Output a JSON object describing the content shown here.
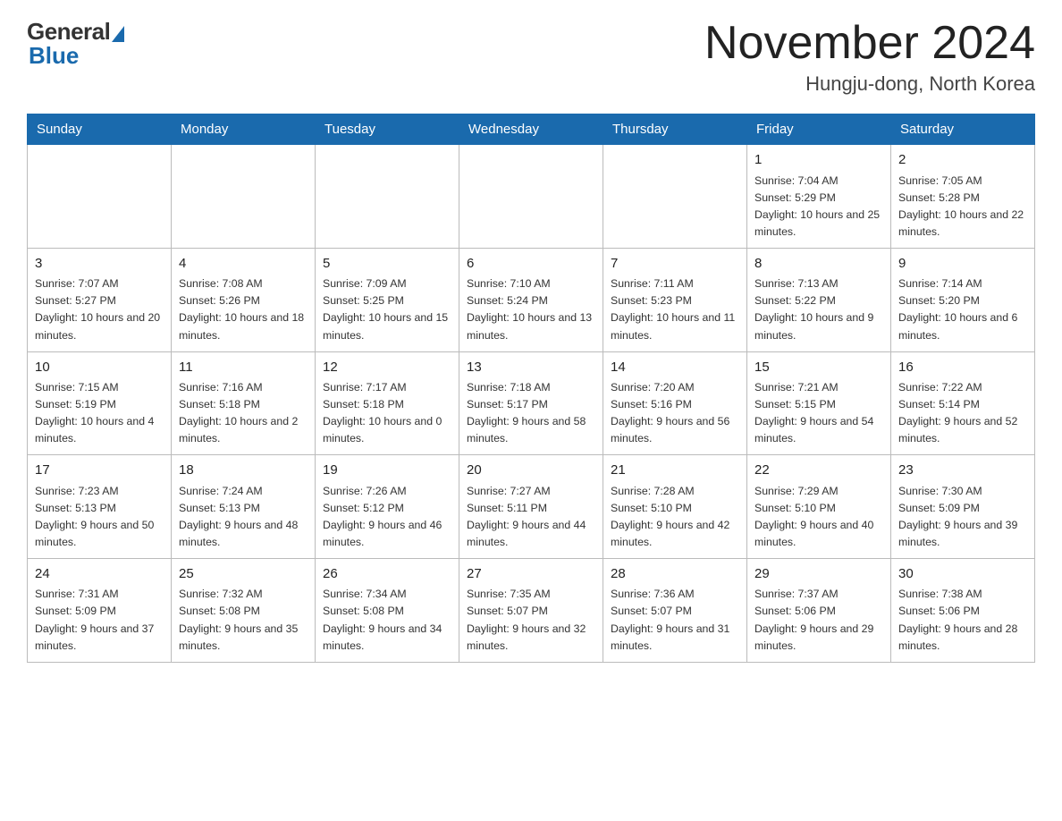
{
  "logo": {
    "general": "General",
    "blue": "Blue"
  },
  "header": {
    "title": "November 2024",
    "location": "Hungju-dong, North Korea"
  },
  "weekdays": [
    "Sunday",
    "Monday",
    "Tuesday",
    "Wednesday",
    "Thursday",
    "Friday",
    "Saturday"
  ],
  "weeks": [
    [
      {
        "day": "",
        "info": ""
      },
      {
        "day": "",
        "info": ""
      },
      {
        "day": "",
        "info": ""
      },
      {
        "day": "",
        "info": ""
      },
      {
        "day": "",
        "info": ""
      },
      {
        "day": "1",
        "info": "Sunrise: 7:04 AM\nSunset: 5:29 PM\nDaylight: 10 hours and 25 minutes."
      },
      {
        "day": "2",
        "info": "Sunrise: 7:05 AM\nSunset: 5:28 PM\nDaylight: 10 hours and 22 minutes."
      }
    ],
    [
      {
        "day": "3",
        "info": "Sunrise: 7:07 AM\nSunset: 5:27 PM\nDaylight: 10 hours and 20 minutes."
      },
      {
        "day": "4",
        "info": "Sunrise: 7:08 AM\nSunset: 5:26 PM\nDaylight: 10 hours and 18 minutes."
      },
      {
        "day": "5",
        "info": "Sunrise: 7:09 AM\nSunset: 5:25 PM\nDaylight: 10 hours and 15 minutes."
      },
      {
        "day": "6",
        "info": "Sunrise: 7:10 AM\nSunset: 5:24 PM\nDaylight: 10 hours and 13 minutes."
      },
      {
        "day": "7",
        "info": "Sunrise: 7:11 AM\nSunset: 5:23 PM\nDaylight: 10 hours and 11 minutes."
      },
      {
        "day": "8",
        "info": "Sunrise: 7:13 AM\nSunset: 5:22 PM\nDaylight: 10 hours and 9 minutes."
      },
      {
        "day": "9",
        "info": "Sunrise: 7:14 AM\nSunset: 5:20 PM\nDaylight: 10 hours and 6 minutes."
      }
    ],
    [
      {
        "day": "10",
        "info": "Sunrise: 7:15 AM\nSunset: 5:19 PM\nDaylight: 10 hours and 4 minutes."
      },
      {
        "day": "11",
        "info": "Sunrise: 7:16 AM\nSunset: 5:18 PM\nDaylight: 10 hours and 2 minutes."
      },
      {
        "day": "12",
        "info": "Sunrise: 7:17 AM\nSunset: 5:18 PM\nDaylight: 10 hours and 0 minutes."
      },
      {
        "day": "13",
        "info": "Sunrise: 7:18 AM\nSunset: 5:17 PM\nDaylight: 9 hours and 58 minutes."
      },
      {
        "day": "14",
        "info": "Sunrise: 7:20 AM\nSunset: 5:16 PM\nDaylight: 9 hours and 56 minutes."
      },
      {
        "day": "15",
        "info": "Sunrise: 7:21 AM\nSunset: 5:15 PM\nDaylight: 9 hours and 54 minutes."
      },
      {
        "day": "16",
        "info": "Sunrise: 7:22 AM\nSunset: 5:14 PM\nDaylight: 9 hours and 52 minutes."
      }
    ],
    [
      {
        "day": "17",
        "info": "Sunrise: 7:23 AM\nSunset: 5:13 PM\nDaylight: 9 hours and 50 minutes."
      },
      {
        "day": "18",
        "info": "Sunrise: 7:24 AM\nSunset: 5:13 PM\nDaylight: 9 hours and 48 minutes."
      },
      {
        "day": "19",
        "info": "Sunrise: 7:26 AM\nSunset: 5:12 PM\nDaylight: 9 hours and 46 minutes."
      },
      {
        "day": "20",
        "info": "Sunrise: 7:27 AM\nSunset: 5:11 PM\nDaylight: 9 hours and 44 minutes."
      },
      {
        "day": "21",
        "info": "Sunrise: 7:28 AM\nSunset: 5:10 PM\nDaylight: 9 hours and 42 minutes."
      },
      {
        "day": "22",
        "info": "Sunrise: 7:29 AM\nSunset: 5:10 PM\nDaylight: 9 hours and 40 minutes."
      },
      {
        "day": "23",
        "info": "Sunrise: 7:30 AM\nSunset: 5:09 PM\nDaylight: 9 hours and 39 minutes."
      }
    ],
    [
      {
        "day": "24",
        "info": "Sunrise: 7:31 AM\nSunset: 5:09 PM\nDaylight: 9 hours and 37 minutes."
      },
      {
        "day": "25",
        "info": "Sunrise: 7:32 AM\nSunset: 5:08 PM\nDaylight: 9 hours and 35 minutes."
      },
      {
        "day": "26",
        "info": "Sunrise: 7:34 AM\nSunset: 5:08 PM\nDaylight: 9 hours and 34 minutes."
      },
      {
        "day": "27",
        "info": "Sunrise: 7:35 AM\nSunset: 5:07 PM\nDaylight: 9 hours and 32 minutes."
      },
      {
        "day": "28",
        "info": "Sunrise: 7:36 AM\nSunset: 5:07 PM\nDaylight: 9 hours and 31 minutes."
      },
      {
        "day": "29",
        "info": "Sunrise: 7:37 AM\nSunset: 5:06 PM\nDaylight: 9 hours and 29 minutes."
      },
      {
        "day": "30",
        "info": "Sunrise: 7:38 AM\nSunset: 5:06 PM\nDaylight: 9 hours and 28 minutes."
      }
    ]
  ]
}
